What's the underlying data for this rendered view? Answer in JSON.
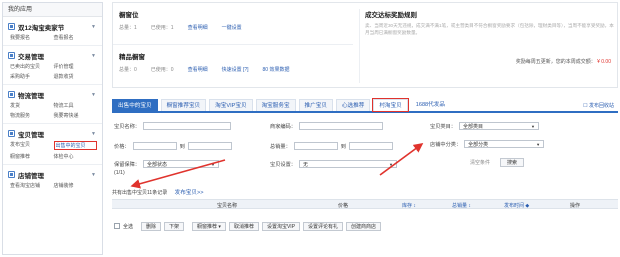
{
  "sidebar": {
    "title": "我的应用",
    "groups": [
      {
        "name": "双12淘宝卖家节",
        "links": [
          "我要报名",
          "查看报名"
        ]
      },
      {
        "name": "交易管理",
        "links": [
          "已卖出的宝贝",
          "评价管理",
          "采购助手",
          "退款收货"
        ]
      },
      {
        "name": "物流管理",
        "links": [
          "发货",
          "物流工具",
          "物流服务",
          "我要寄快递"
        ]
      },
      {
        "name": "宝贝管理",
        "links": [
          "发布宝贝",
          "出售中的宝贝",
          "橱窗推荐",
          "体检中心"
        ]
      },
      {
        "name": "店铺管理",
        "links": [
          "查看淘宝店铺",
          "店铺装修"
        ]
      }
    ]
  },
  "topinfo": {
    "window_title": "橱窗位",
    "window_used": "总量：1",
    "window_usedcount": "已使用：1",
    "window_link1": "查看明细",
    "window_link2": "一键设置",
    "boutique_title": "精品橱窗",
    "boutique_total": "总量：0",
    "boutique_used": "已使用：0",
    "boutique_link1": "查看明细",
    "boutique_link2": "快速设置 [?]",
    "boutique_link3": "80 效果数据",
    "rules_title": "成交达标奖励规则",
    "rules_desc": "卖、当周近30天无违规，成交满不满1笔，或主营类目不符合橱窗奖励要求（包括除，理财类目等），当周不能享受奖励，本月当周已满橱窗奖励数量。",
    "prize_label": "奖励每周五更新，您的本周成交额：",
    "prize_value": "¥ 0.00"
  },
  "tabs": {
    "items": [
      "出售中的宝贝",
      "橱窗推荐宝贝",
      "淘宝VIP宝贝",
      "淘宝服务宝",
      "推广宝贝",
      "心选推荐",
      "村淘宝贝",
      "1688代发品"
    ],
    "right": "☐ 发布回收站"
  },
  "filter": {
    "title_label": "宝贝名称：",
    "merchant_code_label": "商家编码：",
    "category_label": "宝贝类目：",
    "category_value": "全部类目",
    "price_label": "价格：",
    "to": "到",
    "sales_label": "总销量：",
    "store_category_label": "店铺中分类：",
    "store_category_value": "全部分类",
    "warranty_label": "保留保障：",
    "warranty_value": "全部状态",
    "setting_label": "宝贝设置：",
    "setting_value": "无",
    "clear": "清空条件",
    "search": "搜索",
    "pager": "(1/1)",
    "count_text": "共有出售中宝贝11条记录",
    "release_link": "发布宝贝>>"
  },
  "table": {
    "headers": [
      "宝贝名称",
      "价格",
      "库存 ↕",
      "总销量 ↕",
      "发布时间 ◆",
      "操作"
    ]
  },
  "actions": {
    "select_all": "全选",
    "buttons": [
      "删除",
      "下架",
      "橱窗推荐 ▾",
      "取消推荐",
      "设置淘宝VIP",
      "设置评论有礼",
      "创建商商店"
    ]
  }
}
